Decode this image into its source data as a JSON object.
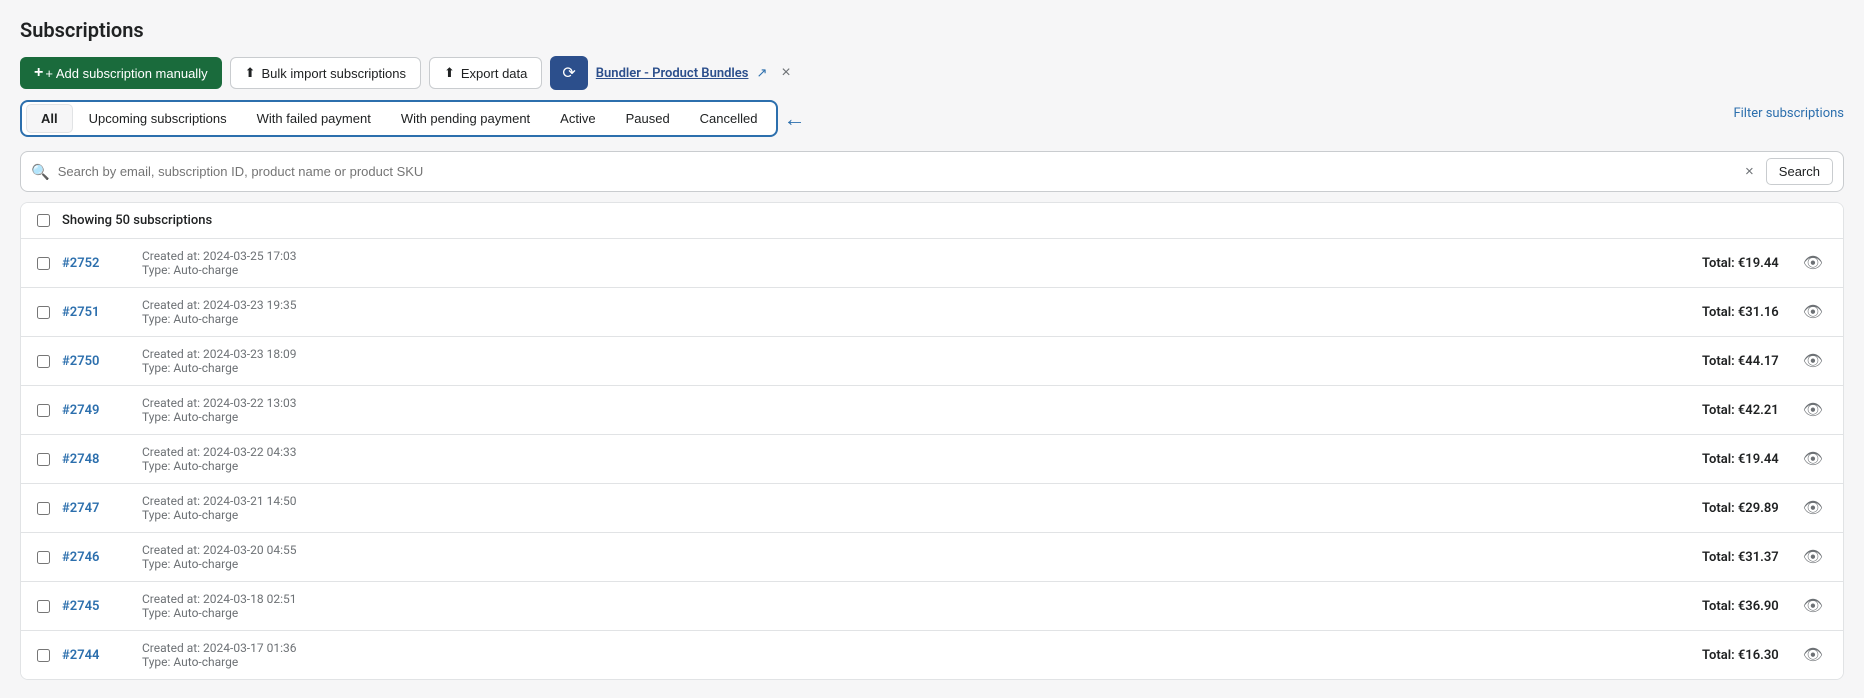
{
  "page": {
    "title": "Subscriptions"
  },
  "toolbar": {
    "add_label": "+ Add subscription manually",
    "bulk_import_label": "Bulk import subscriptions",
    "export_label": "Export data",
    "app_label": "Bundler - Product Bundles",
    "app_external_icon": "↗",
    "close_icon": "×"
  },
  "filter_annotation": {
    "label": "Filter subscriptions",
    "arrow": "←"
  },
  "tabs": [
    {
      "id": "all",
      "label": "All",
      "active": true
    },
    {
      "id": "upcoming",
      "label": "Upcoming subscriptions",
      "active": false
    },
    {
      "id": "failed_payment",
      "label": "With failed payment",
      "active": false
    },
    {
      "id": "pending_payment",
      "label": "With pending payment",
      "active": false
    },
    {
      "id": "active",
      "label": "Active",
      "active": false
    },
    {
      "id": "paused",
      "label": "Paused",
      "active": false
    },
    {
      "id": "cancelled",
      "label": "Cancelled",
      "active": false
    }
  ],
  "search": {
    "placeholder": "Search by email, subscription ID, product name or product SKU",
    "button_label": "Search",
    "clear_icon": "×"
  },
  "table": {
    "showing_label": "Showing 50 subscriptions",
    "rows": [
      {
        "id": "#2752",
        "created": "Created at: 2024-03-25 17:03",
        "type": "Type: Auto-charge",
        "total": "Total: €19.44"
      },
      {
        "id": "#2751",
        "created": "Created at: 2024-03-23 19:35",
        "type": "Type: Auto-charge",
        "total": "Total: €31.16"
      },
      {
        "id": "#2750",
        "created": "Created at: 2024-03-23 18:09",
        "type": "Type: Auto-charge",
        "total": "Total: €44.17"
      },
      {
        "id": "#2749",
        "created": "Created at: 2024-03-22 13:03",
        "type": "Type: Auto-charge",
        "total": "Total: €42.21"
      },
      {
        "id": "#2748",
        "created": "Created at: 2024-03-22 04:33",
        "type": "Type: Auto-charge",
        "total": "Total: €19.44"
      },
      {
        "id": "#2747",
        "created": "Created at: 2024-03-21 14:50",
        "type": "Type: Auto-charge",
        "total": "Total: €29.89"
      },
      {
        "id": "#2746",
        "created": "Created at: 2024-03-20 04:55",
        "type": "Type: Auto-charge",
        "total": "Total: €31.37"
      },
      {
        "id": "#2745",
        "created": "Created at: 2024-03-18 02:51",
        "type": "Type: Auto-charge",
        "total": "Total: €36.90"
      },
      {
        "id": "#2744",
        "created": "Created at: 2024-03-17 01:36",
        "type": "Type: Auto-charge",
        "total": "Total: €16.30"
      }
    ]
  }
}
